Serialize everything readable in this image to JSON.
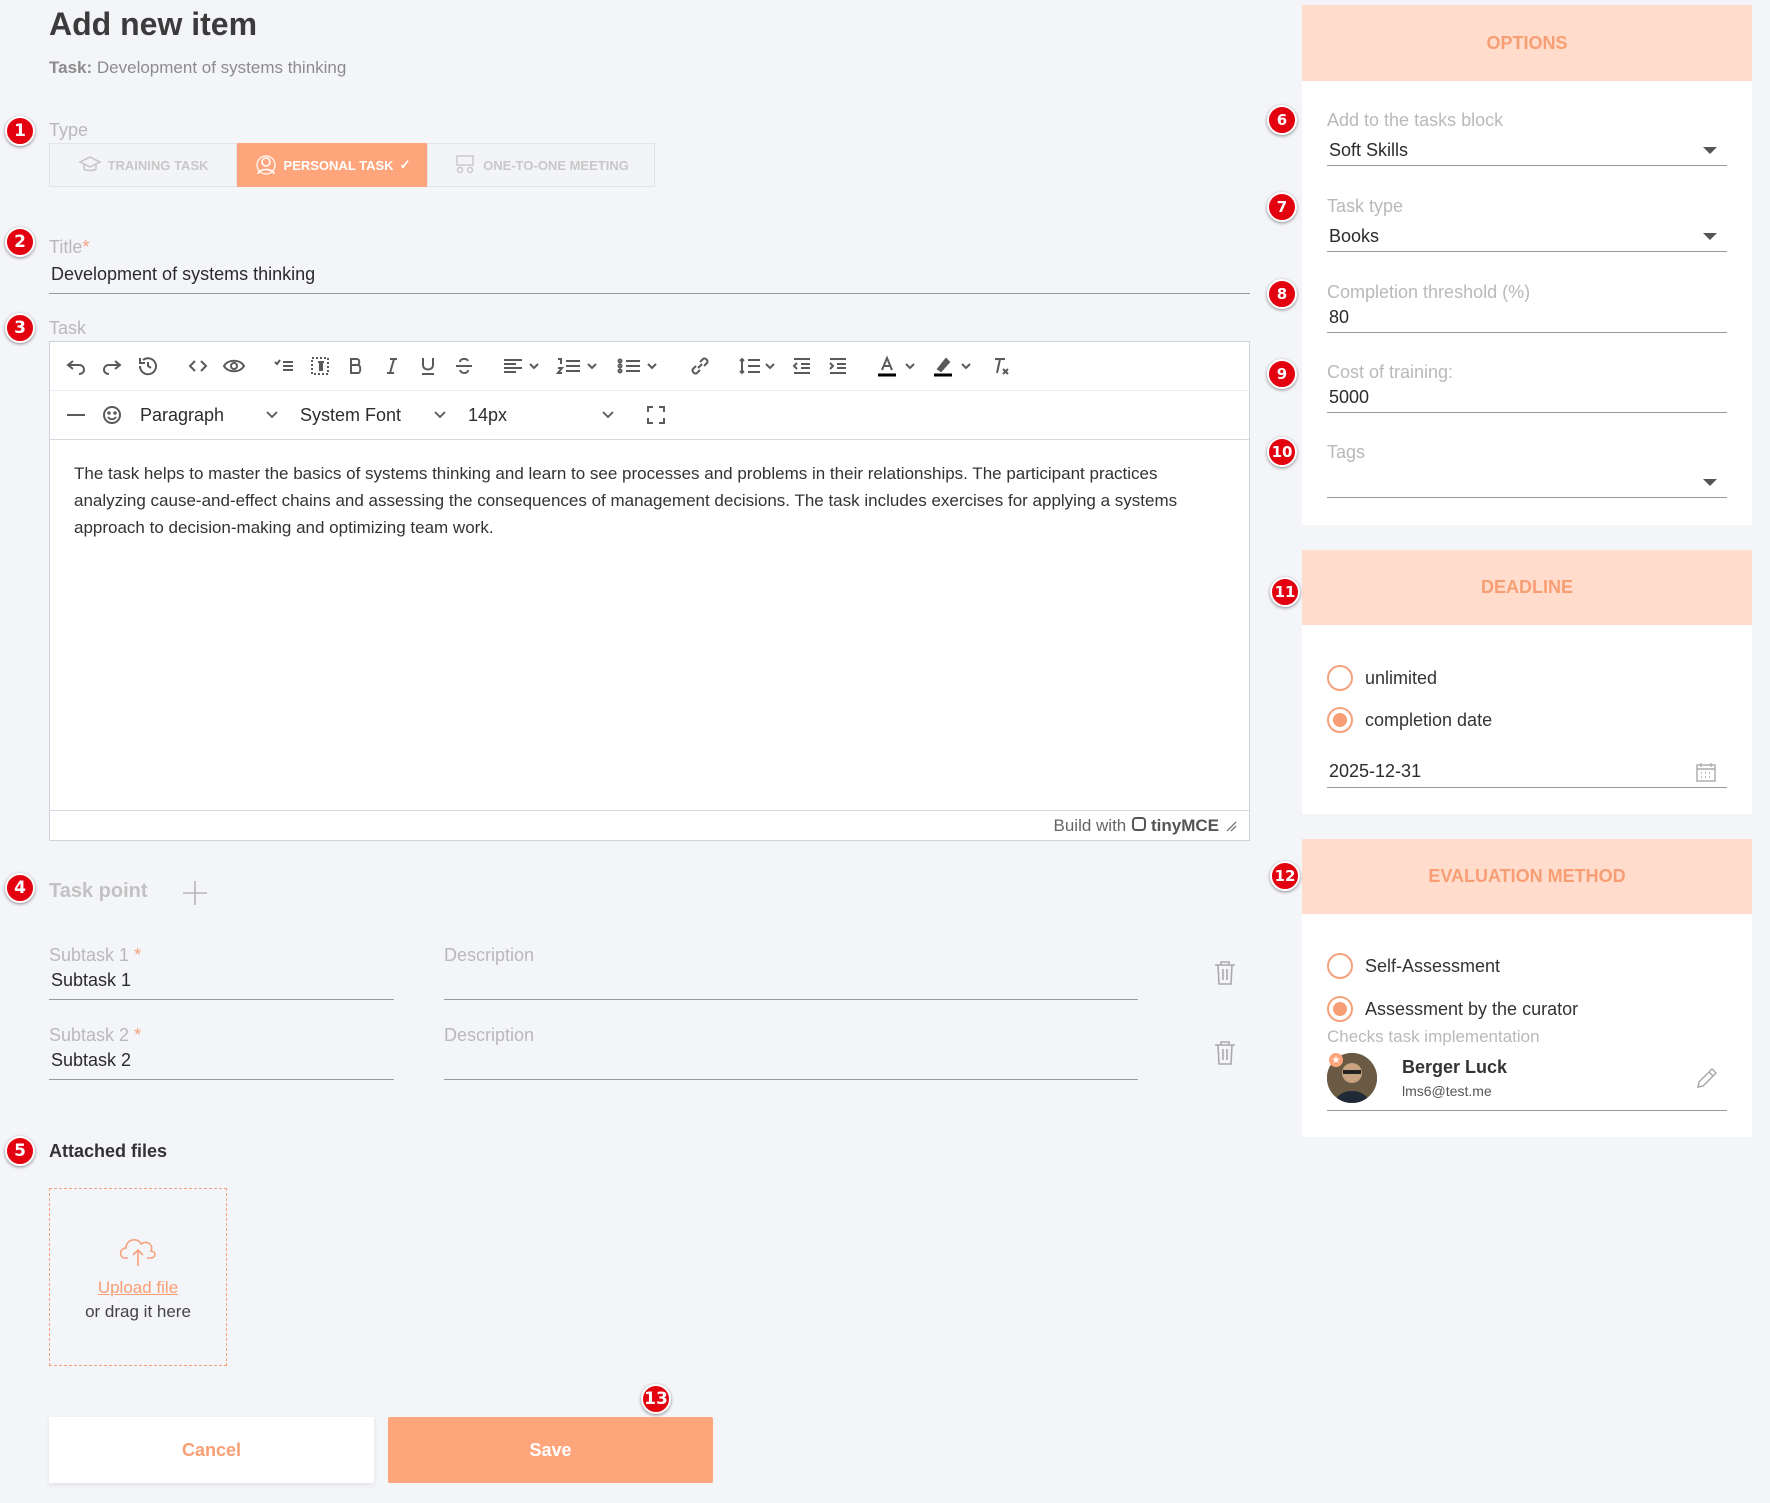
{
  "page": {
    "title": "Add new item",
    "task_label": "Task:",
    "task_name": "Development of systems thinking"
  },
  "type": {
    "label": "Type",
    "options": [
      "TRAINING TASK",
      "PERSONAL TASK",
      "ONE-TO-ONE MEETING"
    ],
    "selected": "PERSONAL TASK"
  },
  "title_field": {
    "label": "Title",
    "required_mark": "*",
    "value": "Development of systems thinking"
  },
  "task_field": {
    "label": "Task",
    "block_format": "Paragraph",
    "font_family": "System Font",
    "font_size": "14px",
    "content": "The task helps to master the basics of systems thinking and learn to see processes and problems in their relationships. The participant practices analyzing cause-and-effect chains and assessing the consequences of management decisions. The task includes exercises for applying a systems approach to decision-making and optimizing team work.",
    "footer_text": "Build with",
    "footer_brand": "tinyMCE"
  },
  "task_point": {
    "label": "Task point",
    "subtasks": [
      {
        "label": "Subtask 1",
        "required_mark": "*",
        "value": "Subtask 1",
        "description_placeholder": "Description"
      },
      {
        "label": "Subtask 2",
        "required_mark": "*",
        "value": "Subtask 2",
        "description_placeholder": "Description"
      }
    ]
  },
  "attached_files": {
    "label": "Attached files",
    "upload_link": "Upload file",
    "upload_hint": "or drag it here"
  },
  "actions": {
    "cancel": "Cancel",
    "save": "Save"
  },
  "options": {
    "header": "OPTIONS",
    "tasks_block": {
      "label": "Add to the tasks block",
      "value": "Soft Skills"
    },
    "task_type": {
      "label": "Task type",
      "value": "Books"
    },
    "threshold": {
      "label": "Completion threshold (%)",
      "value": "80"
    },
    "cost": {
      "label": "Cost of training:",
      "value": "5000"
    },
    "tags": {
      "label": "Tags",
      "value": ""
    }
  },
  "deadline": {
    "header": "DEADLINE",
    "options": [
      "unlimited",
      "completion date"
    ],
    "selected": "completion date",
    "date": "2025-12-31"
  },
  "evaluation": {
    "header": "EVALUATION METHOD",
    "options": [
      "Self-Assessment",
      "Assessment by the curator"
    ],
    "selected": "Assessment by the curator",
    "checker_label": "Checks task implementation",
    "curator": {
      "name": "Berger Luck",
      "email": "lms6@test.me"
    }
  },
  "markers": [
    "1",
    "2",
    "3",
    "4",
    "5",
    "6",
    "7",
    "8",
    "9",
    "10",
    "11",
    "12",
    "13"
  ],
  "colors": {
    "accent": "#ffa57c",
    "header_bg": "#ffdccb",
    "marker": "#e3000f",
    "background": "#f4f5f9"
  }
}
